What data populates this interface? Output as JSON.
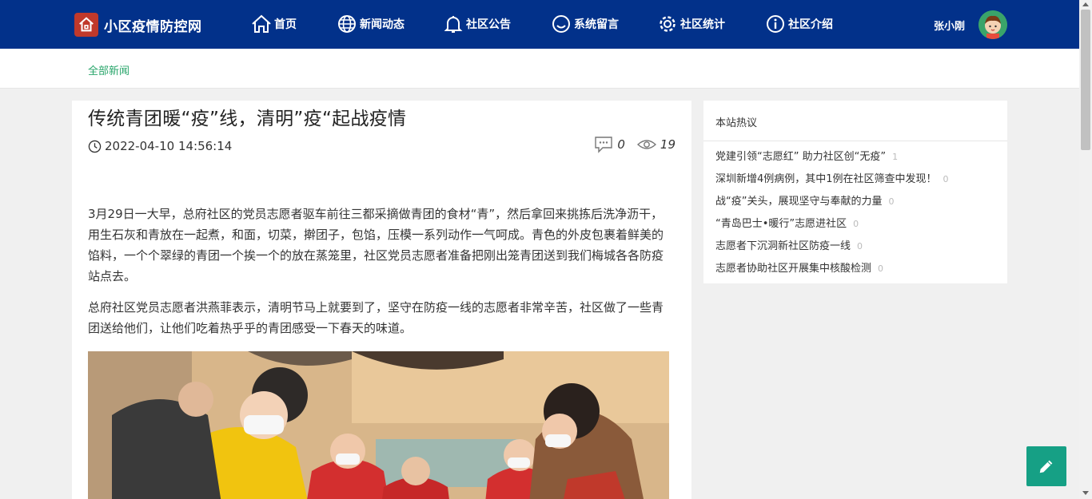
{
  "site": {
    "title": "小区疫情防控网",
    "logo_icon": "home-logo-icon"
  },
  "nav": {
    "items": [
      {
        "label": "首页",
        "icon": "home-icon"
      },
      {
        "label": "新闻动态",
        "icon": "globe-icon"
      },
      {
        "label": "社区公告",
        "icon": "bell-icon"
      },
      {
        "label": "系统留言",
        "icon": "smile-icon"
      },
      {
        "label": "社区统计",
        "icon": "gear-icon"
      },
      {
        "label": "社区介绍",
        "icon": "info-icon"
      }
    ],
    "user_name": "张小刚"
  },
  "breadcrumb": {
    "label": "全部新闻"
  },
  "article": {
    "title": "传统青团暖“疫”线，清明”疫“起战疫情",
    "datetime": "2022-04-10 14:56:14",
    "comments": "0",
    "views": "19",
    "paragraphs": [
      "3月29日一大早，总府社区的党员志愿者驱车前往三都采摘做青团的食材“青”，然后拿回来挑拣后洗净沥干，用生石灰和青放在一起煮，和面，切菜，擀团子，包馅，压模一系列动作一气呵成。青色的外皮包裹着鲜美的馅料，一个个翠绿的青团一个挨一个的放在蒸笼里，社区党员志愿者准备把刚出笼青团送到我们梅城各各防疫站点去。",
      "总府社区党员志愿者洪燕菲表示，清明节马上就要到了，坚守在防疫一线的志愿者非常辛苦，社区做了一些青团送给他们，让他们吃着热乎乎的青团感受一下春天的味道。"
    ]
  },
  "sidebar": {
    "title": "本站热议",
    "items": [
      {
        "text": "党建引领“志愿红” 助力社区创“无疫”",
        "count": "1"
      },
      {
        "text": "深圳新增4例病例，其中1例在社区筛查中发现！",
        "count": "0"
      },
      {
        "text": "战“疫”关头，展现坚守与奉献的力量",
        "count": "0"
      },
      {
        "text": "“青岛巴士•暖行”志愿进社区",
        "count": "0"
      },
      {
        "text": "志愿者下沉洞新社区防疫一线",
        "count": "0"
      },
      {
        "text": "志愿者协助社区开展集中核酸检测",
        "count": "0"
      }
    ]
  },
  "colors": {
    "nav_bg": "#02318a",
    "accent_green": "#27a56a",
    "fab": "#16a085"
  }
}
